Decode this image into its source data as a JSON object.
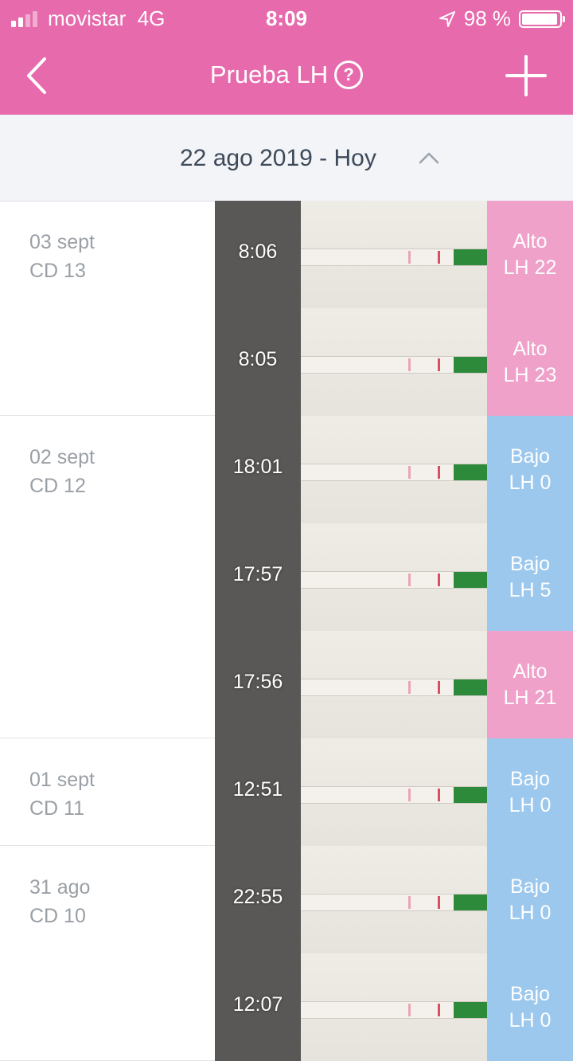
{
  "status_bar": {
    "carrier": "movistar",
    "network": "4G",
    "time": "8:09",
    "battery": "98 %",
    "battery_level": 0.98
  },
  "nav": {
    "title": "Prueba LH",
    "help_icon": "question-circle-icon",
    "back_icon": "chevron-left-icon",
    "add_icon": "plus-icon"
  },
  "range": {
    "label": "22 ago 2019 - Hoy"
  },
  "colors": {
    "brand": "#e66aac",
    "alto": "#efa1c9",
    "bajo": "#9cc8ee"
  },
  "groups": [
    {
      "date": "03 sept",
      "cycle_day": "CD 13",
      "tests": [
        {
          "time": "8:06",
          "level": "Alto",
          "lh": "LH 22"
        },
        {
          "time": "8:05",
          "level": "Alto",
          "lh": "LH 23"
        }
      ]
    },
    {
      "date": "02 sept",
      "cycle_day": "CD 12",
      "tests": [
        {
          "time": "18:01",
          "level": "Bajo",
          "lh": "LH 0"
        },
        {
          "time": "17:57",
          "level": "Bajo",
          "lh": "LH 5"
        },
        {
          "time": "17:56",
          "level": "Alto",
          "lh": "LH 21"
        }
      ]
    },
    {
      "date": "01 sept",
      "cycle_day": "CD 11",
      "tests": [
        {
          "time": "12:51",
          "level": "Bajo",
          "lh": "LH 0"
        }
      ]
    },
    {
      "date": "31 ago",
      "cycle_day": "CD 10",
      "tests": [
        {
          "time": "22:55",
          "level": "Bajo",
          "lh": "LH 0"
        },
        {
          "time": "12:07",
          "level": "Bajo",
          "lh": "LH 0"
        }
      ]
    }
  ]
}
